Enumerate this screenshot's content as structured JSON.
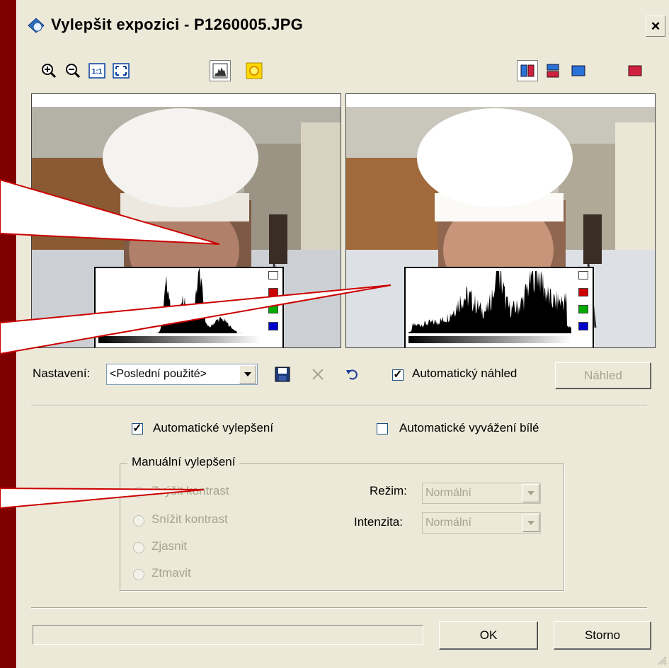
{
  "window": {
    "title": "Vylepšit expozici - P1260005.JPG",
    "close_label": "×"
  },
  "toolbar": {
    "left_tools": [
      "zoom-in-icon",
      "zoom-out-icon",
      "actual-size-icon",
      "fit-window-icon"
    ],
    "view_tools": [
      "histogram-icon",
      "sun-icon"
    ],
    "right_tools": [
      "split-vertical-icon",
      "split-horizontal-icon",
      "single-before-icon",
      "single-after-icon"
    ],
    "actual_size_label": "1:1"
  },
  "settings": {
    "label": "Nastavení:",
    "preset_value": "<Poslední použité>",
    "auto_preview_label": "Automatický náhled",
    "auto_preview_checked": true,
    "preview_button": "Náhled"
  },
  "options": {
    "auto_enhance_label": "Automatické vylepšení",
    "auto_enhance_checked": true,
    "auto_wb_label": "Automatické vyvážení bílé",
    "auto_wb_checked": false
  },
  "manual": {
    "legend": "Manuální vylepšení",
    "radios": [
      "Zvýšit kontrast",
      "Snížit kontrast",
      "Zjasnit",
      "Ztmavit"
    ],
    "mode_label": "Režim:",
    "mode_value": "Normální",
    "intensity_label": "Intenzita:",
    "intensity_value": "Normální"
  },
  "footer": {
    "ok": "OK",
    "cancel": "Storno"
  },
  "colors": {
    "background": "#800000",
    "dialog": "#ece9d8",
    "callout_line": "#cc0000",
    "histogram_channels": [
      "#ffffff",
      "#cc0000",
      "#00aa00",
      "#0000cc"
    ]
  }
}
